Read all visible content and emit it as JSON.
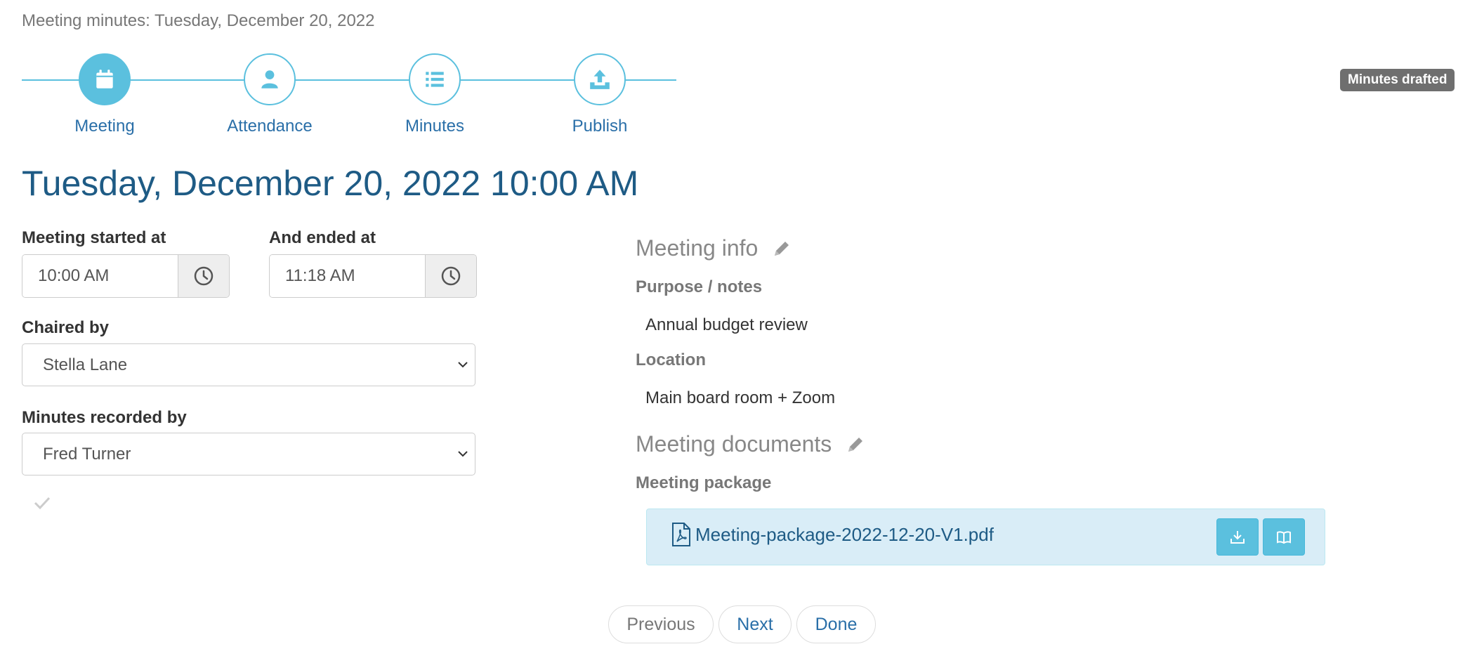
{
  "page_header": "Meeting minutes: Tuesday, December 20, 2022",
  "status_badge": "Minutes drafted",
  "steps": [
    {
      "label": "Meeting",
      "icon": "calendar-icon",
      "active": true
    },
    {
      "label": "Attendance",
      "icon": "user-icon",
      "active": false
    },
    {
      "label": "Minutes",
      "icon": "list-icon",
      "active": false
    },
    {
      "label": "Publish",
      "icon": "upload-icon",
      "active": false
    }
  ],
  "meeting_title": "Tuesday, December 20, 2022 10:00 AM",
  "form": {
    "started_label": "Meeting started at",
    "started_value": "10:00 AM",
    "ended_label": "And ended at",
    "ended_value": "11:18 AM",
    "chaired_label": "Chaired by",
    "chaired_value": "Stella Lane",
    "recorded_label": "Minutes recorded by",
    "recorded_value": "Fred Turner"
  },
  "meeting_info": {
    "title": "Meeting info",
    "purpose_label": "Purpose / notes",
    "purpose_value": "Annual budget review",
    "location_label": "Location",
    "location_value": "Main board room + Zoom"
  },
  "documents": {
    "title": "Meeting documents",
    "package_label": "Meeting package",
    "file_name": "Meeting-package-2022-12-20-V1.pdf"
  },
  "pager": {
    "previous": "Previous",
    "next": "Next",
    "done": "Done"
  },
  "colors": {
    "accent": "#5bc0de",
    "title": "#1e5b85",
    "link": "#2a6fa8",
    "badge": "#6f6f6f"
  }
}
